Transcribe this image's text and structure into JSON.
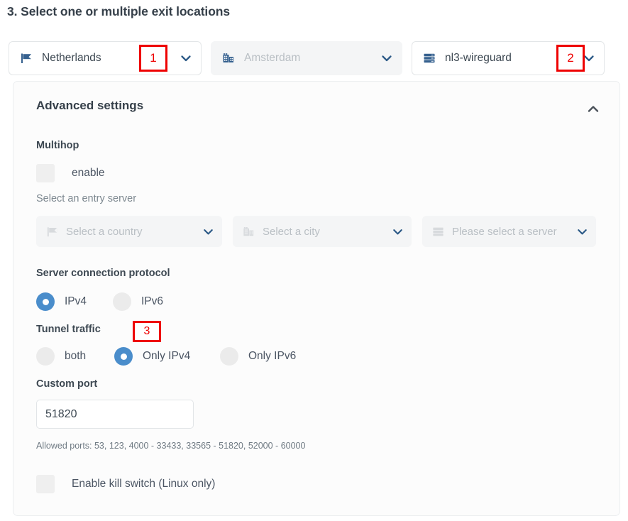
{
  "step": {
    "title": "3. Select one or multiple exit locations"
  },
  "exit_location": {
    "country": {
      "value": "Netherlands",
      "icon": "flag-icon",
      "chevron": "chevron-down-icon",
      "disabled": false
    },
    "city": {
      "value": "Amsterdam",
      "icon": "city-building-icon",
      "chevron": "chevron-down-icon",
      "disabled": true
    },
    "server": {
      "value": "nl3-wireguard",
      "icon": "server-stack-icon",
      "chevron": "chevron-down-icon",
      "disabled": false
    }
  },
  "annotations": [
    {
      "id": "1",
      "label": "1"
    },
    {
      "id": "2",
      "label": "2"
    },
    {
      "id": "3",
      "label": "3"
    }
  ],
  "advanced": {
    "title": "Advanced settings",
    "collapse_icon": "chevron-up-icon",
    "multihop": {
      "title": "Multihop",
      "enable_label": "enable",
      "enabled": false,
      "entry_label": "Select an entry server",
      "entry_country_placeholder": "Select a country",
      "entry_city_placeholder": "Select a city",
      "entry_server_placeholder": "Please select a server"
    },
    "protocol": {
      "title": "Server connection protocol",
      "options": [
        {
          "label": "IPv4",
          "selected": true
        },
        {
          "label": "IPv6",
          "selected": false
        }
      ]
    },
    "tunnel": {
      "title": "Tunnel traffic",
      "options": [
        {
          "label": "both",
          "selected": false
        },
        {
          "label": "Only IPv4",
          "selected": true
        },
        {
          "label": "Only IPv6",
          "selected": false
        }
      ]
    },
    "custom_port": {
      "title": "Custom port",
      "value": "51820",
      "allowed": "Allowed ports: 53, 123, 4000 - 33433, 33565 - 51820, 52000 - 60000"
    },
    "kill_switch": {
      "label": "Enable kill switch (Linux only)",
      "enabled": false
    }
  },
  "colors": {
    "accent_blue": "#4a8dcb",
    "icon_blue": "#36618f",
    "annotation_red": "#ee0000",
    "text_dark": "#36404a",
    "text_muted": "#7c878f",
    "disabled_bg": "#f4f5f6"
  }
}
